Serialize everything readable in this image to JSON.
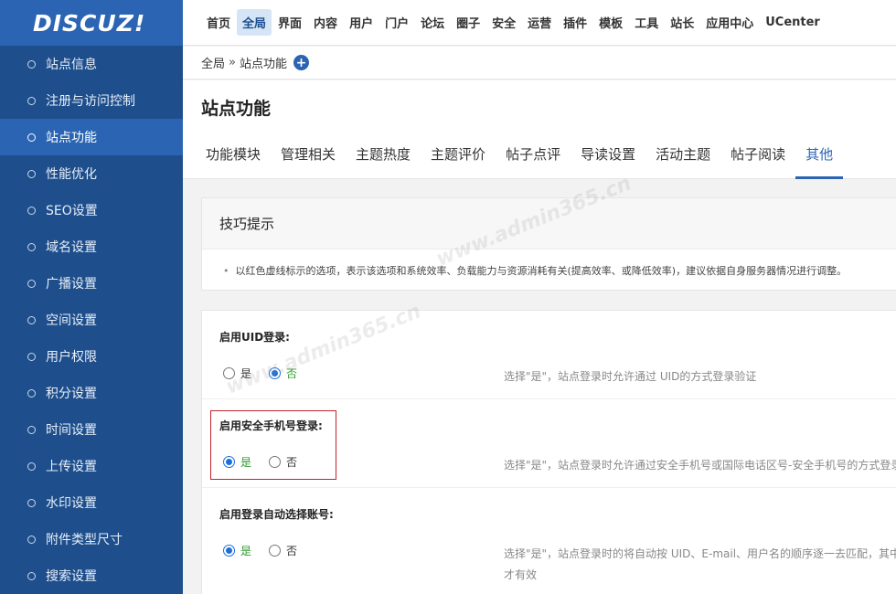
{
  "logo": "DISCUZ!",
  "sidebar": {
    "items": [
      {
        "label": "站点信息"
      },
      {
        "label": "注册与访问控制"
      },
      {
        "label": "站点功能"
      },
      {
        "label": "性能优化"
      },
      {
        "label": "SEO设置"
      },
      {
        "label": "域名设置"
      },
      {
        "label": "广播设置"
      },
      {
        "label": "空间设置"
      },
      {
        "label": "用户权限"
      },
      {
        "label": "积分设置"
      },
      {
        "label": "时间设置"
      },
      {
        "label": "上传设置"
      },
      {
        "label": "水印设置"
      },
      {
        "label": "附件类型尺寸"
      },
      {
        "label": "搜索设置"
      }
    ],
    "active_index": 2
  },
  "topnav": {
    "items": [
      "首页",
      "全局",
      "界面",
      "内容",
      "用户",
      "门户",
      "论坛",
      "圈子",
      "安全",
      "运营",
      "插件",
      "模板",
      "工具",
      "站长",
      "应用中心",
      "UCenter"
    ],
    "active_index": 1
  },
  "breadcrumb": {
    "root": "全局",
    "separator": "»",
    "current": "站点功能",
    "plus": "+"
  },
  "page": {
    "title": "站点功能"
  },
  "tabs": {
    "items": [
      "功能模块",
      "管理相关",
      "主题热度",
      "主题评价",
      "帖子点评",
      "导读设置",
      "活动主题",
      "帖子阅读",
      "其他"
    ],
    "active_index": 8
  },
  "tips": {
    "title": "技巧提示",
    "bullet": "•",
    "text": "以红色虚线标示的选项，表示该选项和系统效率、负载能力与资源消耗有关(提高效率、或降低效率)，建议依据自身服务器情况进行调整。"
  },
  "settings": [
    {
      "label": "启用UID登录:",
      "options": [
        "是",
        "否"
      ],
      "selected": 1,
      "description": "选择\"是\"，站点登录时允许通过 UID的方式登录验证",
      "description_cont": ""
    },
    {
      "label": "启用安全手机号登录:",
      "options": [
        "是",
        "否"
      ],
      "selected": 0,
      "description": "选择\"是\"，站点登录时允许通过安全手机号或国际电话区号-安全手机号的方式登录验证",
      "description_cont": ""
    },
    {
      "label": "启用登录自动选择账号:",
      "options": [
        "是",
        "否"
      ],
      "selected": 0,
      "description": "选择\"是\"，站点登录时的将自动按 UID、E-mail、用户名的顺序逐一去匹配，其中",
      "description_cont": "才有效"
    }
  ],
  "watermark": "www.admin365.cn"
}
